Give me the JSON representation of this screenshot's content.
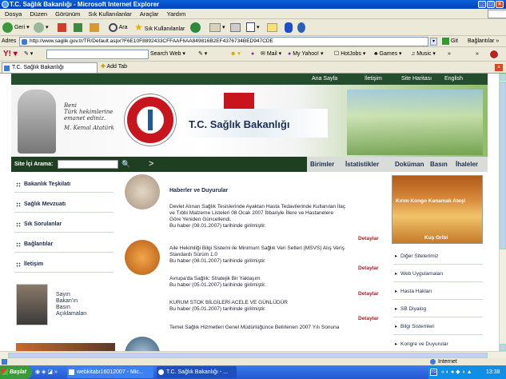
{
  "window": {
    "title": "T.C. Sağlık Bakanlığı - Microsoft Internet Explorer"
  },
  "menu": [
    "Dosya",
    "Düzen",
    "Görünüm",
    "Sık Kullanılanlar",
    "Araçlar",
    "Yardım"
  ],
  "toolbar": {
    "back": "Geri",
    "search": "Ara",
    "favorites": "Sık Kullanılanlar"
  },
  "address": {
    "label": "Adres",
    "url": "http://www.saglik.gov.tr/TR/Default.aspx?F6E10F8892433CFFAAF6AA849816B2EF4376734BED947CDE",
    "go": "Git",
    "links": "Bağlantılar"
  },
  "yahoo": {
    "search_web": "Search Web",
    "mail": "Mail",
    "my_yahoo": "My Yahoo!",
    "hotjobs": "HotJobs",
    "games": "Games",
    "music": "Music"
  },
  "tabs": {
    "active": "T.C. Sağlık Bakanlığı",
    "add": "Add Tab"
  },
  "site": {
    "topnav": [
      "Ana Sayfa",
      "İletişim",
      "Site Haritası",
      "English"
    ],
    "quote": [
      "Beni",
      "Türk hekimlerine",
      "emanet ediniz.",
      "M. Kemal Atatürk"
    ],
    "title": "T.C. Sağlık Bakanlığı",
    "search_label": "Site İçi Arama:",
    "mainnav": [
      "Birimler",
      "İstatistikler",
      "Doküman",
      "Basın",
      "İhaleler"
    ],
    "left_nav": [
      "Bakanlık Teşkilatı",
      "Sağlık Mevzuatı",
      "Sık Sorulanlar",
      "Bağlantılar",
      "İletişim"
    ],
    "minister": [
      "Sayın",
      "Bakan'ın",
      "Basın",
      "Açıklamaları"
    ],
    "news_title": "Haberler ve Duyurular",
    "news": [
      {
        "lines": [
          "Devlet Alınan Sağlık Tesislerinde Ayaktan Hasta Tedavilerinde Kullanılan İlaç",
          "ve Tıbbi Malzeme Listeleri 08 Ocak 2007 İtibariyle İllere ve Hastanelere",
          "Göre Yeniden Güncellendi.",
          "Bu haber (08.01.2007) tarihinde girilmiştir."
        ],
        "more": "Detaylar"
      },
      {
        "lines": [
          "Aile Hekimliği Bilgi Sistemi ile Minimum Sağlık Veri Setleri (MSVS) Alış Veriş",
          "Standardı Sürüm 1.0",
          "Bu haber (08.01.2007) tarihinde girilmiştir."
        ],
        "more": "Detaylar"
      },
      {
        "lines": [
          "Avrupa'da Sağlık: Stratejik Bir Yaklaşım",
          "Bu haber (05.01.2007) tarihinde girilmiştir."
        ],
        "more": "Detaylar"
      },
      {
        "lines": [
          "KURUM STOK BİLGİLERİ ACELE VE GÜNLÜDÜR",
          "Bu haber (05.01.2007) tarihinde girilmiştir."
        ],
        "more": "Detaylar"
      },
      {
        "lines": [
          "Temel Sağlık Hizmetleri Genel Müdürlüğünce Belirlenen 2007 Yılı Sonuna"
        ],
        "more": ""
      }
    ],
    "promo": {
      "top": "Kırım Kongo Kanamalı Ateşi",
      "bottom": "Kuş Gribi"
    },
    "right_links": [
      "Diğer Sitelerimiz",
      "Web Uygulamaları",
      "Hasta Hakları",
      "SB Diyalog",
      "Bilgi Sistemleri",
      "Kongre ve Duyurular"
    ]
  },
  "status": {
    "zone": "Internet"
  },
  "taskbar": {
    "start": "Başlat",
    "items": [
      "webkitabı16012007 - Mic...",
      "T.C. Sağlık Bakanlığı - ..."
    ],
    "clock": "13:38",
    "lang": "TR"
  }
}
